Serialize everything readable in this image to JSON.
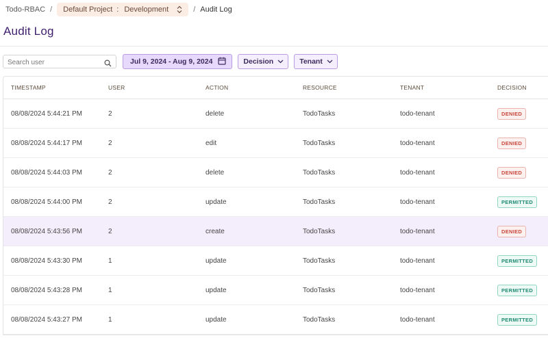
{
  "breadcrumb": {
    "root": "Todo-RBAC",
    "separator": "/",
    "project": "Default Project",
    "project_env_separator": ":",
    "environment": "Development",
    "current": "Audit Log"
  },
  "page": {
    "title": "Audit Log"
  },
  "filters": {
    "search_placeholder": "Search user",
    "search_value": "",
    "date_range": "Jul 9, 2024 - Aug 9, 2024",
    "decision_label": "Decision",
    "tenant_label": "Tenant"
  },
  "table": {
    "columns": [
      "TIMESTAMP",
      "USER",
      "ACTION",
      "RESOURCE",
      "TENANT",
      "DECISION"
    ],
    "rows": [
      {
        "timestamp": "08/08/2024 5:44:21 PM",
        "user": "2",
        "action": "delete",
        "resource": "TodoTasks",
        "tenant": "todo-tenant",
        "decision": "DENIED"
      },
      {
        "timestamp": "08/08/2024 5:44:17 PM",
        "user": "2",
        "action": "edit",
        "resource": "TodoTasks",
        "tenant": "todo-tenant",
        "decision": "DENIED"
      },
      {
        "timestamp": "08/08/2024 5:44:03 PM",
        "user": "2",
        "action": "delete",
        "resource": "TodoTasks",
        "tenant": "todo-tenant",
        "decision": "DENIED"
      },
      {
        "timestamp": "08/08/2024 5:44:00 PM",
        "user": "2",
        "action": "update",
        "resource": "TodoTasks",
        "tenant": "todo-tenant",
        "decision": "PERMITTED"
      },
      {
        "timestamp": "08/08/2024 5:43:56 PM",
        "user": "2",
        "action": "create",
        "resource": "TodoTasks",
        "tenant": "todo-tenant",
        "decision": "DENIED"
      },
      {
        "timestamp": "08/08/2024 5:43:30 PM",
        "user": "1",
        "action": "update",
        "resource": "TodoTasks",
        "tenant": "todo-tenant",
        "decision": "PERMITTED"
      },
      {
        "timestamp": "08/08/2024 5:43:28 PM",
        "user": "1",
        "action": "update",
        "resource": "TodoTasks",
        "tenant": "todo-tenant",
        "decision": "PERMITTED"
      },
      {
        "timestamp": "08/08/2024 5:43:27 PM",
        "user": "1",
        "action": "update",
        "resource": "TodoTasks",
        "tenant": "todo-tenant",
        "decision": "PERMITTED"
      }
    ]
  },
  "colors": {
    "accent": "#3d1e6d",
    "selected_row": "#f4eefc",
    "denied": "#c8453a",
    "permitted": "#1f8a72"
  },
  "icons": [
    "search-icon",
    "calendar-icon",
    "chevron-down-icon",
    "chevron-up-down-icon"
  ]
}
